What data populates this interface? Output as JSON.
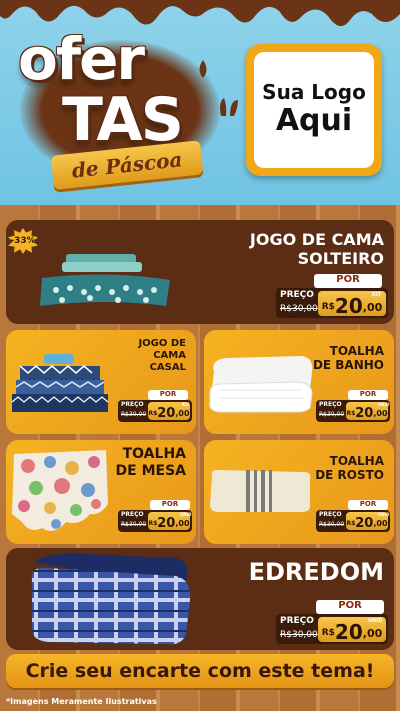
{
  "header": {
    "title_line1": "ofer",
    "title_line2": "TAS",
    "subtitle": "de Páscoa",
    "logo_line1": "Sua Logo",
    "logo_line2": "Aqui"
  },
  "discount_badge": "-33%",
  "products": [
    {
      "name_l1": "JOGO DE CAMA",
      "name_l2": "SOLTEIRO",
      "por": "POR",
      "preco": "PREÇO",
      "old_price": "R$30,00",
      "currency": "R$",
      "price_int": "20",
      "price_dec": ",00",
      "unit": "KIT"
    },
    {
      "name_l1": "JOGO DE",
      "name_l2": "CAMA",
      "name_l3": "CASAL",
      "por": "POR",
      "preco": "PREÇO",
      "old_price": "R$30,00",
      "currency": "R$",
      "price_int": "20",
      "price_dec": ",00",
      "unit": "KIT"
    },
    {
      "name_l1": "TOALHA",
      "name_l2": "DE BANHO",
      "por": "POR",
      "preco": "PREÇO",
      "old_price": "R$30,00",
      "currency": "R$",
      "price_int": "20",
      "price_dec": ",00",
      "unit": "UNID"
    },
    {
      "name_l1": "TOALHA",
      "name_l2": "DE MESA",
      "por": "POR",
      "preco": "PREÇO",
      "old_price": "R$30,00",
      "currency": "R$",
      "price_int": "20",
      "price_dec": ",00",
      "unit": "UNID"
    },
    {
      "name_l1": "TOALHA",
      "name_l2": "DE ROSTO",
      "por": "POR",
      "preco": "PREÇO",
      "old_price": "R$30,00",
      "currency": "R$",
      "price_int": "20",
      "price_dec": ",00",
      "unit": "UNID"
    },
    {
      "name_l1": "EDREDOM",
      "por": "POR",
      "preco": "PREÇO",
      "old_price": "R$30,00",
      "currency": "R$",
      "price_int": "20",
      "price_dec": ",00",
      "unit": "UNID"
    }
  ],
  "cta": "Crie seu encarte com este tema!",
  "footnote": "*Imagens Meramente Ilustrativas",
  "colors": {
    "sky": "#7ccbe7",
    "chocolate": "#5a2d14",
    "gold": "#f0a718",
    "wood": "#b9773c"
  }
}
